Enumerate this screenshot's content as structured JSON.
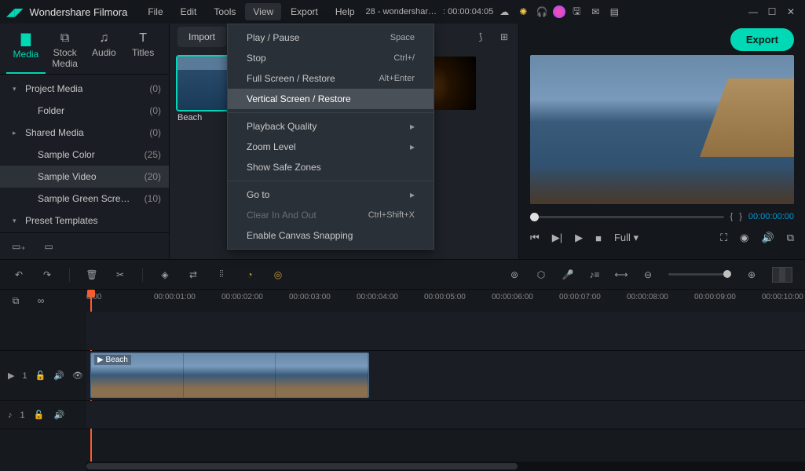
{
  "app": {
    "name": "Wondershare Filmora"
  },
  "menu": {
    "items": [
      "File",
      "Edit",
      "Tools",
      "View",
      "Export",
      "Help"
    ],
    "open_index": 3
  },
  "titlebar": {
    "project": "28 - wondershar…",
    "timecode": ": 00:00:04:05"
  },
  "dropdown": {
    "groups": [
      [
        {
          "label": "Play / Pause",
          "shortcut": "Space"
        },
        {
          "label": "Stop",
          "shortcut": "Ctrl+/"
        },
        {
          "label": "Full Screen / Restore",
          "shortcut": "Alt+Enter"
        },
        {
          "label": "Vertical Screen / Restore",
          "highlight": true
        }
      ],
      [
        {
          "label": "Playback Quality",
          "submenu": true
        },
        {
          "label": "Zoom Level",
          "submenu": true
        },
        {
          "label": "Show Safe Zones"
        }
      ],
      [
        {
          "label": "Go to",
          "submenu": true
        },
        {
          "label": "Clear In And Out",
          "shortcut": "Ctrl+Shift+X",
          "disabled": true
        },
        {
          "label": "Enable Canvas Snapping"
        }
      ]
    ]
  },
  "tabs": [
    {
      "label": "Media",
      "active": true
    },
    {
      "label": "Stock Media"
    },
    {
      "label": "Audio"
    },
    {
      "label": "Titles"
    }
  ],
  "tree": [
    {
      "label": "Project Media",
      "count": "(0)",
      "indent": 0,
      "arrow": "▾"
    },
    {
      "label": "Folder",
      "count": "(0)",
      "indent": 1
    },
    {
      "label": "Shared Media",
      "count": "(0)",
      "indent": 0,
      "arrow": "▸"
    },
    {
      "label": "Sample Color",
      "count": "(25)",
      "indent": 1
    },
    {
      "label": "Sample Video",
      "count": "(20)",
      "indent": 1,
      "selected": true
    },
    {
      "label": "Sample Green Scre…",
      "count": "(10)",
      "indent": 1
    },
    {
      "label": "Preset Templates",
      "indent": 0,
      "arrow": "▾"
    }
  ],
  "import_btn": "Import",
  "thumbs": [
    {
      "name": "Beach",
      "kind": "sea",
      "selected": true
    },
    {
      "name": "",
      "kind": "camera"
    },
    {
      "name": "",
      "kind": "camera"
    }
  ],
  "export_btn": "Export",
  "scrub": {
    "left": "{",
    "right": "}",
    "tc": "00:00:00:00"
  },
  "playbar": {
    "speed": "Full",
    "speed_arrow": "▾"
  },
  "ruler": [
    "0:00",
    "00:00:01:00",
    "00:00:02:00",
    "00:00:03:00",
    "00:00:04:00",
    "00:00:05:00",
    "00:00:06:00",
    "00:00:07:00",
    "00:00:08:00",
    "00:00:09:00",
    "00:00:10:00"
  ],
  "tracks": {
    "video": {
      "label": "1",
      "clip_name": "Beach"
    },
    "audio": {
      "label": "1"
    }
  }
}
